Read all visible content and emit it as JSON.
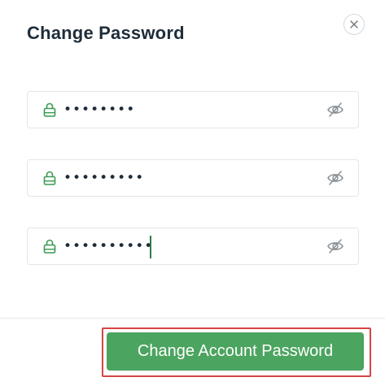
{
  "dialog": {
    "title": "Change Password",
    "close_icon": "close-icon"
  },
  "fields": [
    {
      "name": "current-password",
      "value": "••••••••",
      "lock_icon": "lock-icon",
      "toggle_icon": "eye-off-icon"
    },
    {
      "name": "new-password",
      "value": "•••••••••",
      "lock_icon": "lock-icon",
      "toggle_icon": "eye-off-icon"
    },
    {
      "name": "confirm-password",
      "value": "••••••••••",
      "lock_icon": "lock-icon",
      "toggle_icon": "eye-off-icon"
    }
  ],
  "footer": {
    "submit_label": "Change Account Password"
  },
  "colors": {
    "accent": "#4ba45f",
    "lock_icon": "#3c9a52",
    "highlight": "#d64545",
    "title": "#1f2d3a"
  }
}
